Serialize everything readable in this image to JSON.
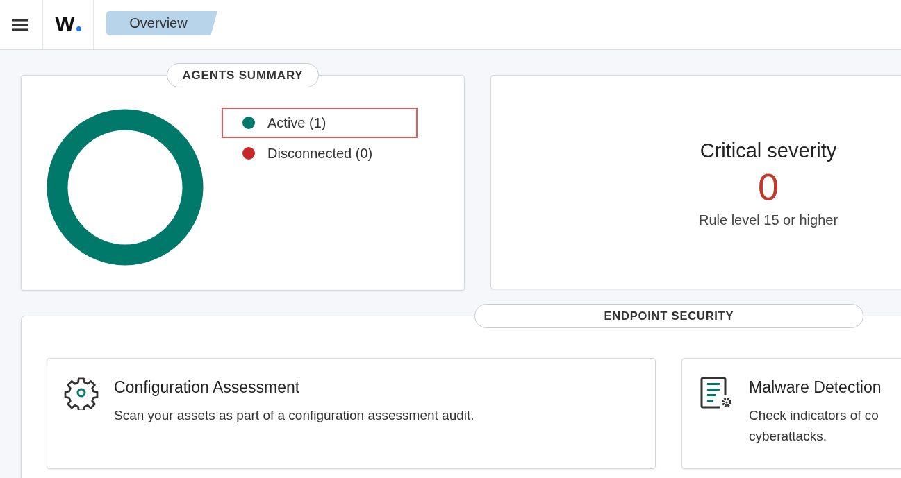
{
  "header": {
    "logo": "W",
    "tab": {
      "label": "Overview",
      "selected": true
    }
  },
  "agents_summary": {
    "title": "AGENTS SUMMARY",
    "legend": [
      {
        "label": "Active (1)",
        "color": "#00796b",
        "highlighted": true
      },
      {
        "label": "Disconnected (0)",
        "color": "#c62828",
        "highlighted": false
      }
    ]
  },
  "critical": {
    "title": "Critical severity",
    "value": "0",
    "subtitle": "Rule level 15 or higher"
  },
  "endpoint_security": {
    "title": "ENDPOINT SECURITY",
    "modules": [
      {
        "kind": "gear",
        "title": "Configuration Assessment",
        "description": [
          "Scan your assets as part of a configuration assessment audit."
        ]
      },
      {
        "kind": "document-gear",
        "title": "Malware Detection",
        "description": [
          "Check indicators of co",
          "cyberattacks."
        ]
      }
    ]
  }
}
